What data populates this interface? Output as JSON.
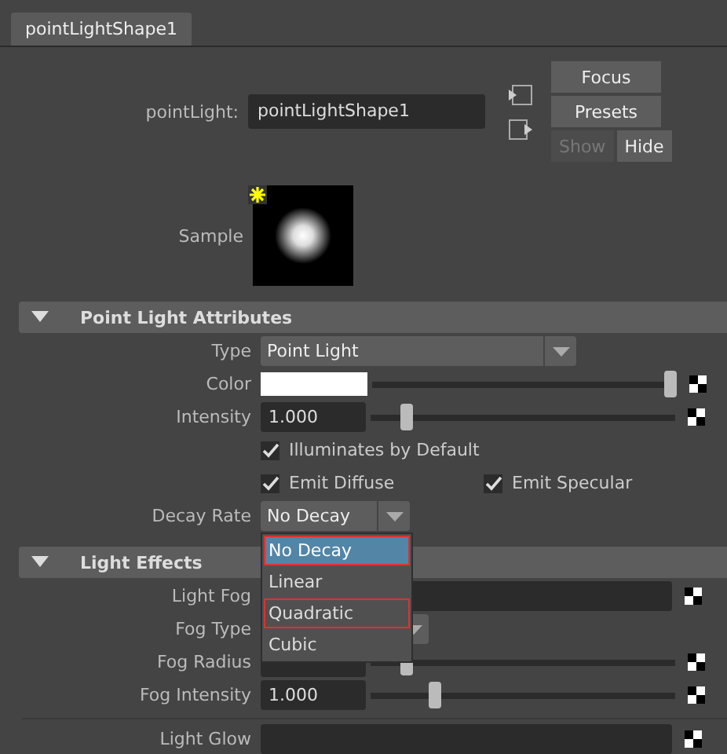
{
  "tab": {
    "label": "pointLightShape1",
    "selected": true
  },
  "node": {
    "label": "pointLight:",
    "value": "pointLightShape1"
  },
  "buttons": [
    "Focus",
    "Presets"
  ],
  "toggle": [
    {
      "label": "Show",
      "selected": false
    },
    {
      "label": "Hide",
      "selected": true
    }
  ],
  "sample": {
    "label": "Sample"
  },
  "sections": [
    {
      "title": "Point Light Attributes",
      "expanded": true,
      "rows": [
        {
          "kind": "dropdown",
          "label": "Type",
          "value": "Point Light"
        },
        {
          "kind": "color",
          "label": "Color",
          "level": 0.98
        },
        {
          "kind": "slider",
          "label": "Intensity",
          "value": "1.000",
          "level": 0.12
        },
        {
          "kind": "checks",
          "items": [
            {
              "label": "Illuminates by Default",
              "checked": true
            }
          ]
        },
        {
          "kind": "checks",
          "items": [
            {
              "label": "Emit Diffuse",
              "checked": true
            },
            {
              "label": "Emit Specular",
              "checked": true
            }
          ]
        },
        {
          "kind": "dropdown",
          "label": "Decay Rate",
          "value": "No Decay",
          "open": true
        }
      ]
    },
    {
      "title": "Light Effects",
      "expanded": true,
      "rows": [
        {
          "kind": "field",
          "label": "Light Fog"
        },
        {
          "kind": "dropdown",
          "label": "Fog Type"
        },
        {
          "kind": "slider",
          "label": "Fog Radius",
          "level": 0.12
        },
        {
          "kind": "slider",
          "label": "Fog Intensity",
          "value": "1.000",
          "level": 0.21
        },
        {
          "kind": "field",
          "label": "Light Glow",
          "separated": true
        }
      ]
    }
  ],
  "popup": {
    "items": [
      {
        "label": "No Decay",
        "selected": true,
        "highlighted": true
      },
      {
        "label": "Linear",
        "selected": false,
        "highlighted": false
      },
      {
        "label": "Quadratic",
        "selected": false,
        "highlighted": true
      },
      {
        "label": "Cubic",
        "selected": false,
        "highlighted": false
      }
    ]
  }
}
